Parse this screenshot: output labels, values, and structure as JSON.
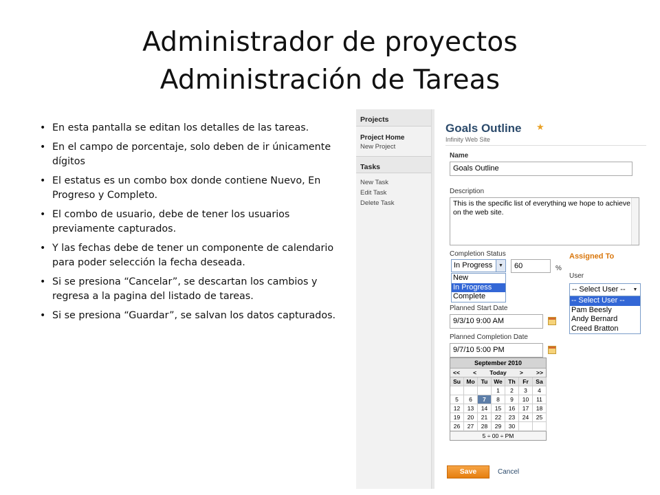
{
  "slide": {
    "title_line1": "Administrador de proyectos",
    "title_line2": "Administración de Tareas",
    "bullets": [
      "En esta pantalla se editan los detalles de las tareas.",
      "En el campo de porcentaje, solo deben de ir únicamente dígitos",
      "El estatus es un combo box donde contiene Nuevo, En Progreso y Completo.",
      "El combo de usuario, debe de tener los usuarios previamente capturados.",
      "Y las fechas debe de tener un componente de calendario para poder selección la fecha deseada.",
      "Si se presiona “Cancelar”, se descartan los cambios y regresa a la pagina del listado de tareas.",
      "Si se presiona “Guardar”, se salvan los datos capturados."
    ]
  },
  "sidebar": {
    "projects_header": "Projects",
    "project_home": "Project Home",
    "new_project": "New Project",
    "tasks_header": "Tasks",
    "new_task": "New Task",
    "edit_task": "Edit Task",
    "delete_task": "Delete Task"
  },
  "form": {
    "title": "Goals Outline",
    "subtitle": "Infinity Web Site",
    "name_label": "Name",
    "name_value": "Goals Outline",
    "description_label": "Description",
    "description_value": "This is the specific list of everything we hope to achieve on the web site.",
    "status_label": "Completion Status",
    "status_selected": "In Progress",
    "status_options": [
      "New",
      "In Progress",
      "Complete"
    ],
    "percent_value": "60",
    "percent_sign": "%",
    "assigned_to": "Assigned To",
    "user_label": "User",
    "user_selected": "-- Select User --",
    "user_options": [
      "-- Select User --",
      "Pam Beesly",
      "Andy Bernard",
      "Creed Bratton"
    ],
    "start_label": "Planned Start Date",
    "start_value": "9/3/10 9:00 AM",
    "completion_label": "Planned Completion Date",
    "completion_value": "9/7/10 5:00 PM",
    "save_label": "Save",
    "cancel_label": "Cancel"
  },
  "calendar": {
    "month": "September 2010",
    "prev_year": "<<",
    "prev": "<",
    "today": "Today",
    "next": ">",
    "next_year": ">>",
    "days": [
      "Su",
      "Mo",
      "Tu",
      "We",
      "Th",
      "Fr",
      "Sa"
    ],
    "weeks": [
      [
        "",
        "",
        "",
        "1",
        "2",
        "3",
        "4"
      ],
      [
        "5",
        "6",
        "7",
        "8",
        "9",
        "10",
        "11"
      ],
      [
        "12",
        "13",
        "14",
        "15",
        "16",
        "17",
        "18"
      ],
      [
        "19",
        "20",
        "21",
        "22",
        "23",
        "24",
        "25"
      ],
      [
        "26",
        "27",
        "28",
        "29",
        "30",
        "",
        ""
      ]
    ],
    "highlighted": "7",
    "time": "5 ÷ 00 ÷ PM"
  }
}
